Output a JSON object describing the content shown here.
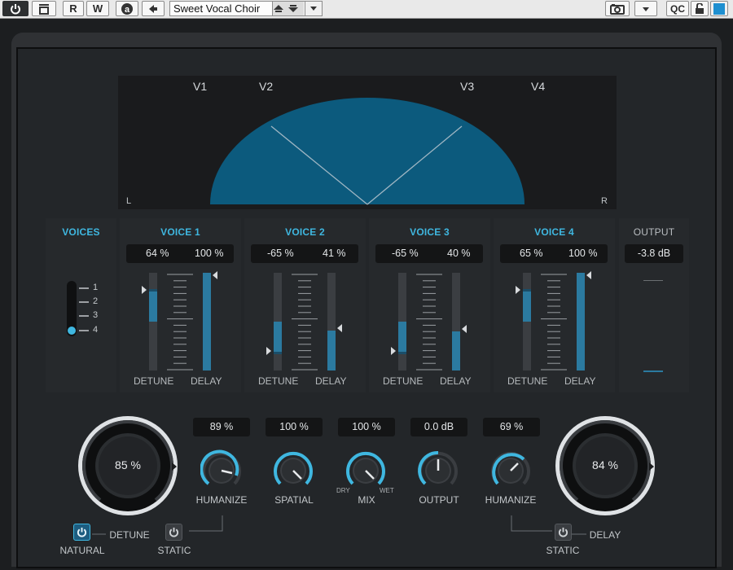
{
  "toolbar": {
    "buttons": [
      {
        "label": "",
        "icon": "power-icon"
      },
      {
        "label": "",
        "icon": "bypass-icon"
      },
      {
        "label": "R"
      },
      {
        "label": "W"
      },
      {
        "label": "",
        "icon": "a-circle-icon"
      },
      {
        "label": "",
        "icon": "arrow-left-icon"
      }
    ],
    "preset_name": "Sweet Vocal Choir",
    "right_buttons": [
      {
        "label": "",
        "icon": "camera-icon"
      },
      {
        "label": "",
        "icon": "dropdown-icon"
      },
      {
        "label": "QC"
      },
      {
        "label": "",
        "icon": "lock-icon"
      },
      {
        "label": "",
        "icon": "color-swatch-icon"
      }
    ]
  },
  "display": {
    "voice_labels": [
      "V1",
      "V2",
      "V3",
      "V4"
    ],
    "left_label": "L",
    "right_label": "R",
    "accent": "#0c5a7d"
  },
  "voices_section": {
    "title": "VOICES",
    "options": [
      "1",
      "2",
      "3",
      "4"
    ],
    "selected": "4"
  },
  "voices": [
    {
      "title": "VOICE 1",
      "detune": "64 %",
      "delay": "100 %",
      "detune_value": 0.64,
      "delay_value": 1.0
    },
    {
      "title": "VOICE 2",
      "detune": "-65 %",
      "delay": "41 %",
      "detune_value": -0.65,
      "delay_value": 0.41
    },
    {
      "title": "VOICE 3",
      "detune": "-65 %",
      "delay": "40 %",
      "detune_value": -0.65,
      "delay_value": 0.4
    },
    {
      "title": "VOICE 4",
      "detune": "65 %",
      "delay": "100 %",
      "detune_value": 0.65,
      "delay_value": 1.0
    }
  ],
  "fader_labels": {
    "detune": "DETUNE",
    "delay": "DELAY"
  },
  "output_section": {
    "title": "OUTPUT",
    "value": "-3.8 dB"
  },
  "bottom": {
    "detune_knob": {
      "value": "85 %",
      "label": "DETUNE"
    },
    "delay_knob": {
      "value": "84 %",
      "label": "DELAY"
    },
    "humanize_left": {
      "value": "89 %",
      "label": "HUMANIZE"
    },
    "spatial": {
      "value": "100 %",
      "label": "SPATIAL"
    },
    "mix": {
      "value": "100 %",
      "label": "MIX",
      "dry": "DRY",
      "wet": "WET"
    },
    "output": {
      "value": "0.0 dB",
      "label": "OUTPUT"
    },
    "humanize_right": {
      "value": "69 %",
      "label": "HUMANIZE"
    },
    "natural": {
      "label": "NATURAL",
      "active": true
    },
    "static_left": {
      "label": "STATIC",
      "active": false
    },
    "static_right": {
      "label": "STATIC",
      "active": false
    }
  }
}
